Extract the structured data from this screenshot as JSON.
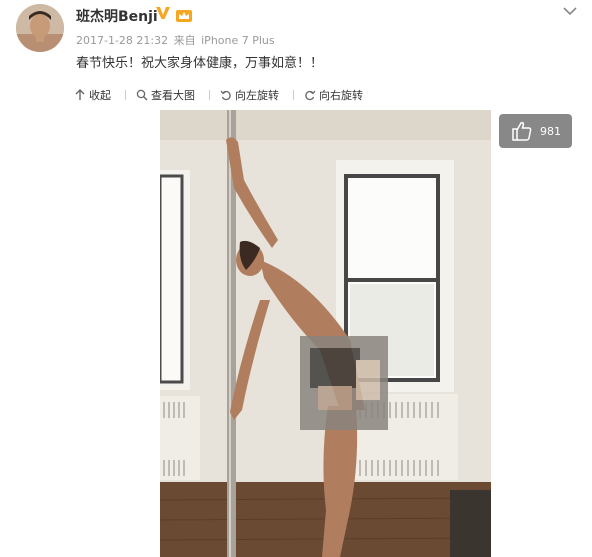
{
  "post": {
    "username": "班杰明Benji",
    "date": "2017-1-28 21:32",
    "source_prefix": "来自",
    "source_device": "iPhone 7 Plus",
    "text": "春节快乐！祝大家身体健康，万事如意！！"
  },
  "toolbar": {
    "collapse_label": "收起",
    "view_large_label": "查看大图",
    "rotate_left_label": "向左旋转",
    "rotate_right_label": "向右旋转"
  },
  "image": {
    "like_count": "981"
  },
  "icons": {
    "verified": "verified-v-icon",
    "level": "member-crown-icon",
    "more": "chevron-down-icon",
    "collapse": "arrow-up-icon",
    "view_large": "magnifier-icon",
    "rotate_left": "rotate-left-icon",
    "rotate_right": "rotate-right-icon",
    "like": "thumbs-up-icon"
  },
  "colors": {
    "verified": "#f5a623",
    "meta_text": "#999999",
    "badge_bg": "#888888"
  }
}
